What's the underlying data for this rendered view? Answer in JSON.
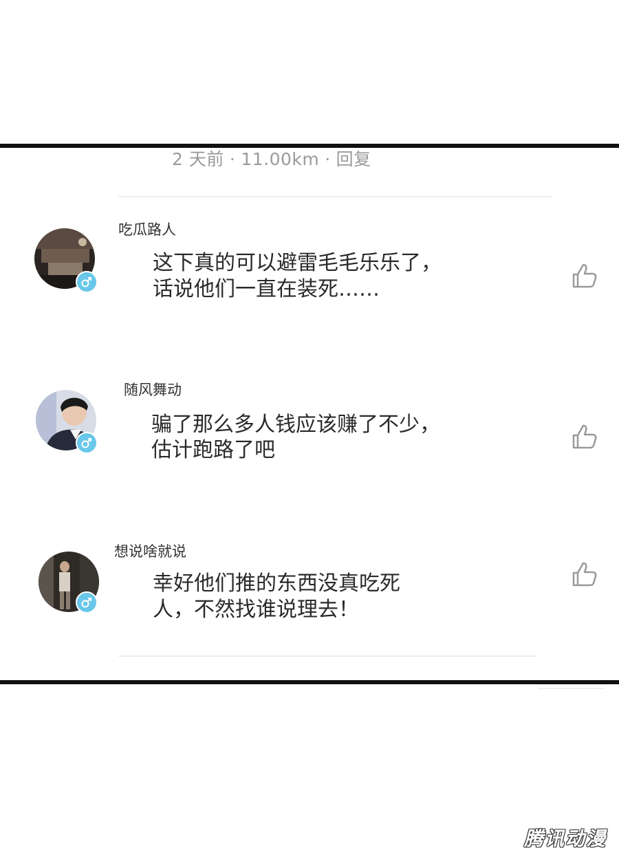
{
  "top_meta": {
    "time": "2 天前",
    "distance": "11.00km",
    "reply": "回复",
    "separator": "·"
  },
  "comments": [
    {
      "username": "吃瓜路人",
      "lines": [
        "这下真的可以避雷毛毛乐乐了，",
        "话说他们一直在装死……"
      ],
      "gender_icon": "male-icon"
    },
    {
      "username": "随风舞动",
      "lines": [
        "骗了那么多人钱应该赚了不少，",
        "估计跑路了吧"
      ],
      "gender_icon": "male-icon"
    },
    {
      "username": "想说啥就说",
      "lines": [
        "幸好他们推的东西没真吃死",
        "人，不然找谁说理去！"
      ],
      "gender_icon": "male-icon"
    }
  ],
  "watermark": "腾讯动漫",
  "colors": {
    "gender_badge": "#69c7ea",
    "meta_text": "#9a9a9a",
    "frame": "#111111"
  }
}
